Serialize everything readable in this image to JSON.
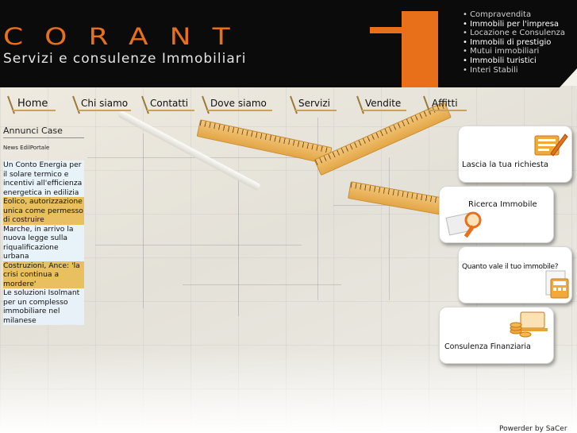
{
  "brand": {
    "name": "CORANT",
    "tagline": "Servizi e consulenze Immobiliari",
    "accent_color": "#e8701a",
    "header_color": "#0b0b0b"
  },
  "services": [
    "Compravendita",
    "Immobili per l'impresa",
    "Locazione e Consulenza",
    "Immobili di prestigio",
    "Mutui immobiliari",
    "Immobili turistici",
    "Interi Stabili"
  ],
  "nav": [
    {
      "label": "Home"
    },
    {
      "label": "Chi siamo"
    },
    {
      "label": "Contatti"
    },
    {
      "label": "Dove siamo"
    },
    {
      "label": "Servizi"
    },
    {
      "label": "Vendite"
    },
    {
      "label": "Affitti"
    }
  ],
  "sidebar": {
    "annunci": "Annunci Case",
    "news_title": "News EdilPortale",
    "news": [
      {
        "text": "Un Conto Energia per il solare termico e incentivi all'efficienza energetica in edilizia",
        "highlight": false
      },
      {
        "text": "Eolico, autorizzazione unica come permesso di costruire",
        "highlight": true
      },
      {
        "text": "Marche, in arrivo la nuova legge sulla riqualificazione urbana",
        "highlight": false
      },
      {
        "text": "Costruzioni, Ance: 'la crisi continua a mordere'",
        "highlight": true
      },
      {
        "text": "Le soluzioni Isolmant per un complesso immobiliare nel milanese",
        "highlight": false
      }
    ]
  },
  "actions": {
    "richiesta": "Lascia la tua richiesta",
    "ricerca": "Ricerca Immobile",
    "valutazione": "Quanto vale il tuo immobile?",
    "finanziaria": "Consulenza Finanziaria"
  },
  "icons": {
    "richiesta": "form-pen-icon",
    "ricerca": "magnifier-document-icon",
    "valutazione": "calculator-document-icon",
    "finanziaria": "coins-laptop-icon"
  },
  "footer": {
    "credit": "Powerder by SaCer"
  }
}
